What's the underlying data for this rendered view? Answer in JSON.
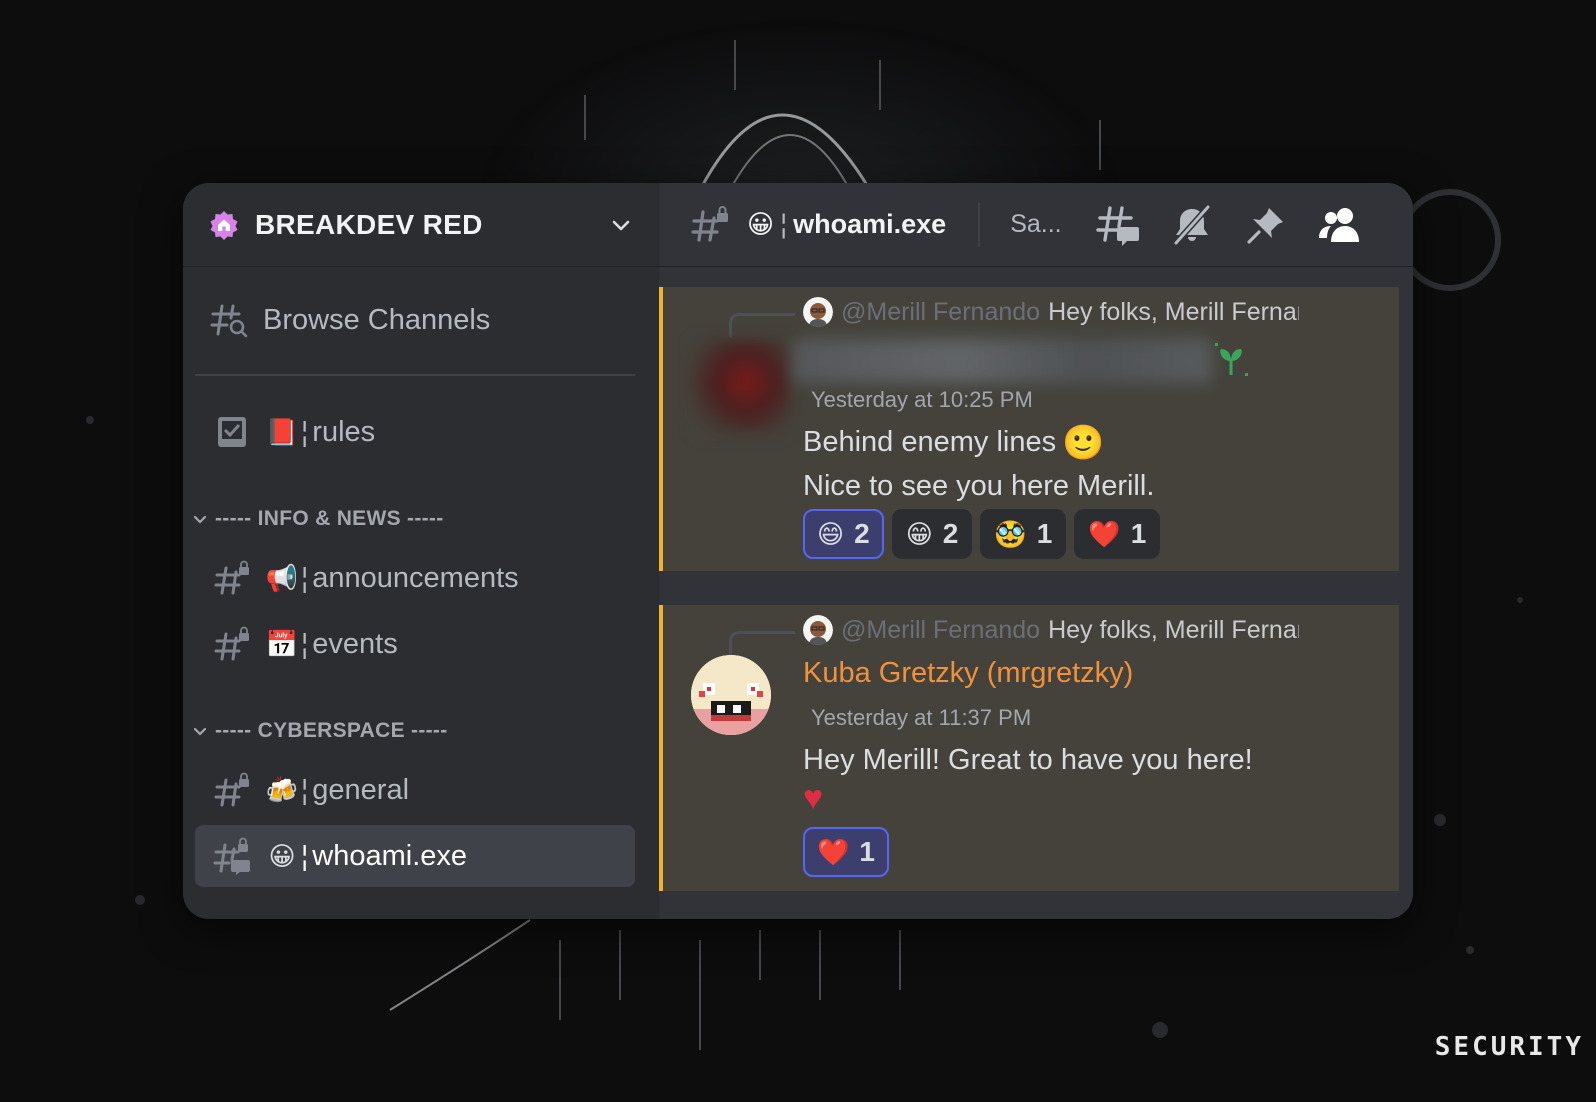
{
  "server": {
    "name": "BREAKDEV RED"
  },
  "channel_header": {
    "emoji": "😀",
    "separator": "¦",
    "name": "whoami.exe",
    "topic": "Sa..."
  },
  "sidebar": {
    "browse_label": "Browse Channels",
    "rules": {
      "emoji": "📕",
      "label": "rules"
    },
    "categories": [
      {
        "label": "----- INFO & NEWS -----"
      },
      {
        "label": "----- CYBERSPACE -----"
      }
    ],
    "channels": [
      {
        "emoji": "📢",
        "label": "announcements"
      },
      {
        "emoji": "📅",
        "label": "events"
      },
      {
        "emoji": "🍻",
        "label": "general"
      },
      {
        "emoji": "😀",
        "label": "whoami.exe"
      }
    ],
    "bar": "¦"
  },
  "messages": [
    {
      "reply_mention": "@Merill Fernando",
      "reply_text": "Hey folks, Merill Fernando",
      "timestamp": "Yesterday at 10:25 PM",
      "lines": [
        "Behind enemy lines",
        "Nice to see you here Merill."
      ],
      "line1_emoji": "🙂",
      "reactions": [
        {
          "emoji": "😄",
          "count": "2",
          "me": true
        },
        {
          "emoji": "😁",
          "count": "2",
          "me": false
        },
        {
          "emoji": "🥸",
          "count": "1",
          "me": false
        },
        {
          "emoji": "❤️",
          "count": "1",
          "me": false
        }
      ]
    },
    {
      "reply_mention": "@Merill Fernando",
      "reply_text": "Hey folks, Merill Fernando",
      "author": "Kuba Gretzky (mrgretzky)",
      "timestamp": "Yesterday at 11:37 PM",
      "lines": [
        "Hey Merill! Great to have you here!"
      ],
      "big_emoji": "♥",
      "reactions": [
        {
          "emoji": "❤️",
          "count": "1",
          "me": true
        }
      ]
    }
  ],
  "watermark": "SECURITY",
  "colors": {
    "accent_gold": "#f0b232",
    "author_orange": "#f0913c",
    "blurple": "#5865f2",
    "sidebar_bg": "#2b2d31",
    "chat_bg": "#313338",
    "highlight_bg": "#44423a"
  },
  "icons": {
    "server": "home-badge-icon",
    "header_channel": "hashtag-lock-icon",
    "threads": "threads-icon",
    "mute": "bell-slash-icon",
    "pin": "pin-icon",
    "members": "members-icon",
    "browse": "hashtag-search-icon",
    "rules": "checkbox-icon"
  }
}
